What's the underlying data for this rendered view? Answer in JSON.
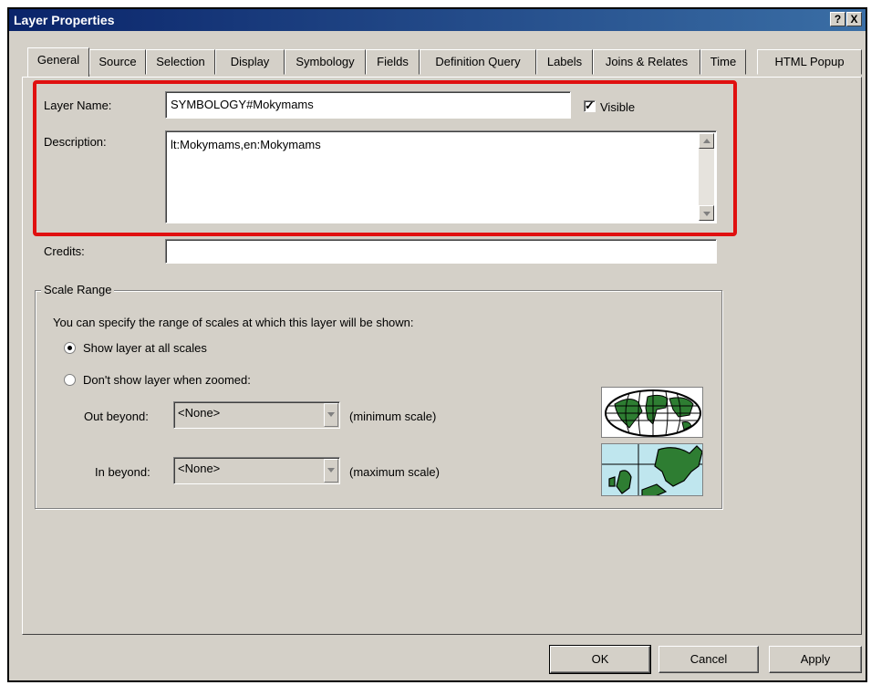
{
  "window": {
    "title": "Layer Properties",
    "help_label": "?",
    "close_label": "X"
  },
  "tabs": [
    {
      "label": "General"
    },
    {
      "label": "Source"
    },
    {
      "label": "Selection"
    },
    {
      "label": "Display"
    },
    {
      "label": "Symbology"
    },
    {
      "label": "Fields"
    },
    {
      "label": "Definition Query"
    },
    {
      "label": "Labels"
    },
    {
      "label": "Joins & Relates"
    },
    {
      "label": "Time"
    },
    {
      "label": "HTML Popup"
    }
  ],
  "general": {
    "layer_name_label": "Layer Name:",
    "layer_name_value": "SYMBOLOGY#Mokymams",
    "visible_label": "Visible",
    "visible_checked": true,
    "description_label": "Description:",
    "description_value": "lt:Mokymams,en:Mokymams",
    "credits_label": "Credits:",
    "credits_value": ""
  },
  "scale_range": {
    "group_label": "Scale Range",
    "intro": "You can specify the range of scales at which this layer will be shown:",
    "option_all": "Show layer at all scales",
    "option_zoomed": "Don't show layer when zoomed:",
    "selected_option": "all",
    "out_beyond_label": "Out beyond:",
    "out_beyond_value": "<None>",
    "out_beyond_hint": "(minimum scale)",
    "in_beyond_label": "In beyond:",
    "in_beyond_value": "<None>",
    "in_beyond_hint": "(maximum scale)"
  },
  "buttons": {
    "ok": "OK",
    "cancel": "Cancel",
    "apply": "Apply"
  }
}
